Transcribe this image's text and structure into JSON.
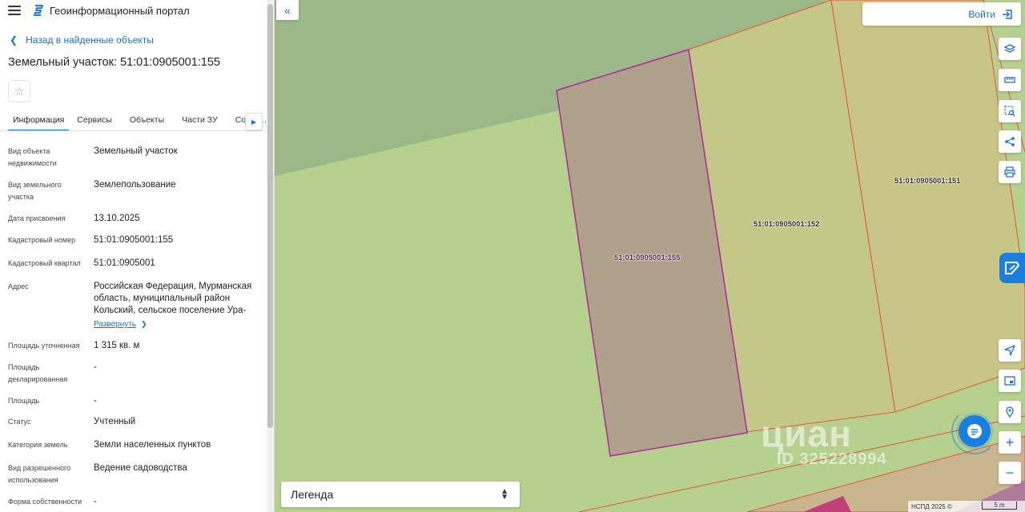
{
  "header": {
    "title": "Геоинформационный портал"
  },
  "nav": {
    "back_label": "Назад в найденные объекты"
  },
  "object": {
    "title": "Земельный участок: 51:01:0905001:155"
  },
  "tabs": [
    {
      "label": "Информация",
      "active": true
    },
    {
      "label": "Сервисы"
    },
    {
      "label": "Объекты"
    },
    {
      "label": "Части ЗУ"
    },
    {
      "label": "Соста…"
    }
  ],
  "properties": [
    {
      "label": "Вид объекта недвижимости",
      "value": "Земельный участок"
    },
    {
      "label": "Вид земельного участка",
      "value": "Землепользование"
    },
    {
      "label": "Дата присвоения",
      "value": "13.10.2025"
    },
    {
      "label": "Кадастровый номер",
      "value": "51:01:0905001:155"
    },
    {
      "label": "Кадастровый квартал",
      "value": "51:01:0905001"
    },
    {
      "label": "Адрес",
      "value": "Российская Федерация, Мурманская область, муниципальный район Кольский, сельское поселение Ура-"
    },
    {
      "label": "Площадь уточненная",
      "value": "1 315 кв. м"
    },
    {
      "label": "Площадь декларированная",
      "value": "-"
    },
    {
      "label": "Площадь",
      "value": "-"
    },
    {
      "label": "Статус",
      "value": "Учтенный"
    },
    {
      "label": "Категория земель",
      "value": "Земли населенных пунктов"
    },
    {
      "label": "Вид разрешенного использования",
      "value": "Ведение садоводства"
    },
    {
      "label": "Форма собственности",
      "value": "-"
    }
  ],
  "address_expand": "Развернуть",
  "map": {
    "login_label": "Войти",
    "legend_label": "Легенда",
    "parcels": [
      {
        "id": "51:01:0905001:155",
        "selected": true
      },
      {
        "id": "51:01:0905001:152"
      },
      {
        "id": "51:01:0905001:151"
      }
    ],
    "watermark": {
      "brand": "циан",
      "id": "ID 325228994"
    },
    "copyright": "НСПД 2025 ©",
    "scale": "5 m",
    "colors": {
      "accent": "#1a6fd6",
      "selected_parcel": "#b0a18c",
      "parcel_border": "#b0279a",
      "neighbor_border": "#e8543a"
    }
  }
}
